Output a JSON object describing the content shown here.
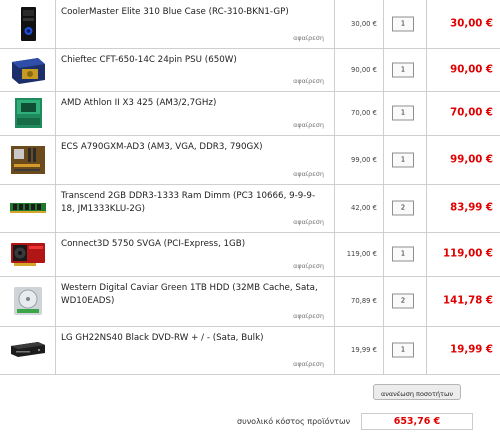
{
  "items": [
    {
      "name": "CoolerMaster Elite 310 Blue Case (RC-310-BKN1-GP)",
      "remove": "αφαίρεση",
      "unit_price": "30,00 €",
      "qty": "1",
      "total": "30,00 €",
      "icon": "pc-case-icon"
    },
    {
      "name": "Chieftec CFT-650-14C 24pin PSU (650W)",
      "remove": "αφαίρεση",
      "unit_price": "90,00 €",
      "qty": "1",
      "total": "90,00 €",
      "icon": "power-supply-icon"
    },
    {
      "name": "AMD Athlon II X3 425 (AM3/2,7GHz)",
      "remove": "αφαίρεση",
      "unit_price": "70,00 €",
      "qty": "1",
      "total": "70,00 €",
      "icon": "cpu-box-icon"
    },
    {
      "name": "ECS A790GXM-AD3 (AM3, VGA, DDR3, 790GX)",
      "remove": "αφαίρεση",
      "unit_price": "99,00 €",
      "qty": "1",
      "total": "99,00 €",
      "icon": "motherboard-icon"
    },
    {
      "name": "Transcend 2GB DDR3-1333 Ram Dimm (PC3 10666, 9-9-9-18, JM1333KLU-2G)",
      "remove": "αφαίρεση",
      "unit_price": "42,00 €",
      "qty": "2",
      "total": "83,99 €",
      "icon": "ram-stick-icon"
    },
    {
      "name": "Connect3D 5750 SVGA (PCI-Express, 1GB)",
      "remove": "αφαίρεση",
      "unit_price": "119,00 €",
      "qty": "1",
      "total": "119,00 €",
      "icon": "graphics-card-icon"
    },
    {
      "name": "Western Digital Caviar Green 1TB HDD (32MB Cache, Sata, WD10EADS)",
      "remove": "αφαίρεση",
      "unit_price": "70,89 €",
      "qty": "2",
      "total": "141,78 €",
      "icon": "hard-drive-icon"
    },
    {
      "name": "LG GH22NS40 Black DVD-RW + / - (Sata, Bulk)",
      "remove": "αφαίρεση",
      "unit_price": "19,99 €",
      "qty": "1",
      "total": "19,99 €",
      "icon": "dvd-drive-icon"
    }
  ],
  "update_button": "ανανέωση ποσοτήτων",
  "grand_total_label": "συνολικό κόστος προϊόντων",
  "grand_total_value": "653,76 €",
  "colors": {
    "total_red": "#e00000",
    "border": "#cfcfcf"
  }
}
